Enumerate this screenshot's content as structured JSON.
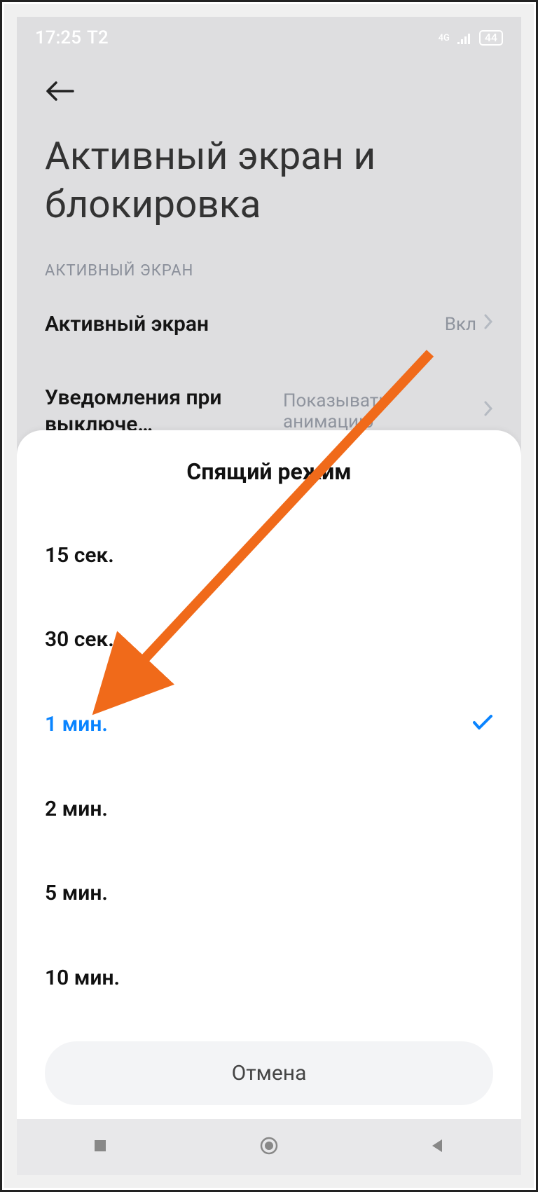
{
  "statusbar": {
    "time": "17:25",
    "carrier": "Т2",
    "network": "4G",
    "battery": "44"
  },
  "header": {
    "title": "Активный экран и блокировка"
  },
  "section": {
    "label": "АКТИВНЫЙ ЭКРАН"
  },
  "rows": [
    {
      "label": "Активный экран",
      "value": "Вкл"
    },
    {
      "label": "Уведомления при выключе…",
      "value": "Показывать анимацию"
    }
  ],
  "sheet": {
    "title": "Спящий режим",
    "options": [
      {
        "label": "15 сек.",
        "selected": false
      },
      {
        "label": "30 сек.",
        "selected": false
      },
      {
        "label": "1 мин.",
        "selected": true
      },
      {
        "label": "2 мин.",
        "selected": false
      },
      {
        "label": "5 мин.",
        "selected": false
      },
      {
        "label": "10 мин.",
        "selected": false
      }
    ],
    "cancel": "Отмена"
  },
  "annotation": {
    "color": "#f06a1a"
  }
}
